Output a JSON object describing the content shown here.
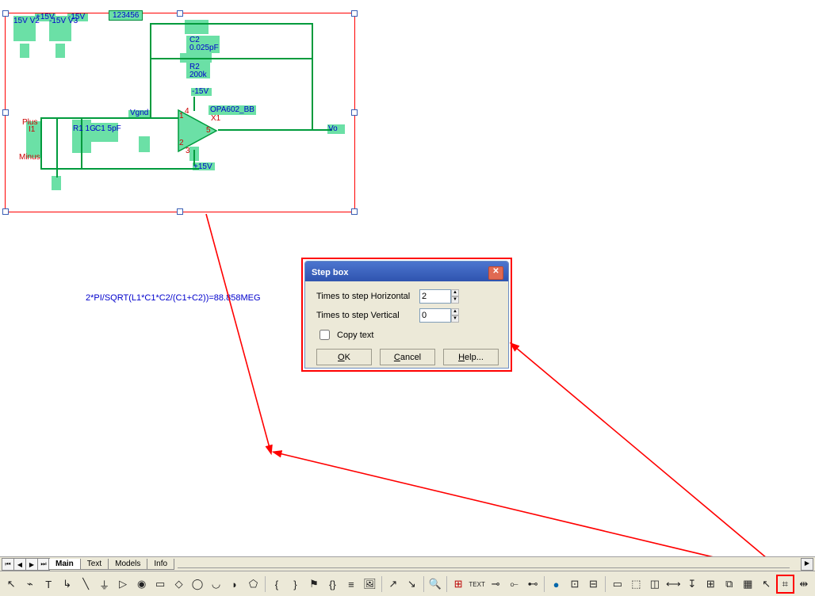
{
  "schematic": {
    "tag_text": "123456",
    "formula": "2*PI/SQRT(L1*C1*C2/(C1+C2))=88.858MEG",
    "labels": {
      "p15v_a": "+15V",
      "m15v_a": "-15V",
      "v2": "15V\nV2",
      "v3": "-15V\nV3",
      "c2": "C2",
      "c2v": "0.025pF",
      "r2": "R2",
      "r2v": "200k",
      "m15v_b": "-15V",
      "p15v_b": "+15V",
      "opamp": "OPA602_BB",
      "x1": "X1",
      "vgnd": "Vgnd",
      "vo": "Vo",
      "r1line": "R1\n1G",
      "c1line": "C1\n5pF",
      "plus": "Plus",
      "minus": "Minus",
      "i1": "I1"
    }
  },
  "dialog": {
    "title": "Step box",
    "fields": {
      "horizontal": {
        "label": "Times to step Horizontal",
        "value": "2"
      },
      "vertical": {
        "label": "Times to step Vertical",
        "value": "0"
      }
    },
    "copy_text_label": "Copy text",
    "buttons": {
      "ok": "OK",
      "cancel": "Cancel",
      "help": "Help..."
    }
  },
  "tabs": [
    "Main",
    "Text",
    "Models",
    "Info"
  ],
  "toolbar_highlight": "step-box-tool"
}
